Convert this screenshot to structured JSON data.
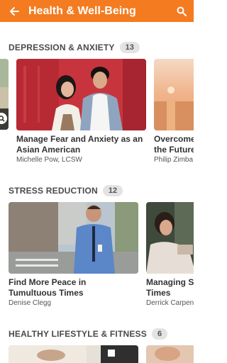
{
  "header": {
    "title": "Health & Well-Being"
  },
  "sections": [
    {
      "title": "DEPRESSION & ANXIETY",
      "count": "13",
      "cards": [
        {
          "title_line1": "Manage Fear and Anxiety as an",
          "title_line2": "Asian American",
          "author": "Michelle Pow, LCSW"
        },
        {
          "title_line1": "Overcome",
          "title_line2": "the Future",
          "author": "Philip Zimba"
        }
      ]
    },
    {
      "title": "STRESS REDUCTION",
      "count": "12",
      "cards": [
        {
          "title_line1": "Find More Peace in",
          "title_line2": "Tumultuous Times",
          "author": "Denise Clegg"
        },
        {
          "title_line1": "Managing S",
          "title_line2": "Times",
          "author": "Derrick Carpen"
        }
      ]
    },
    {
      "title": "HEALTHY LIFESTYLE & FITNESS",
      "count": "6"
    }
  ],
  "colors": {
    "accent": "#f47b20",
    "badge_bg": "#e3e3e3"
  },
  "icons": {
    "back": "arrow-left-icon",
    "search": "search-icon"
  }
}
